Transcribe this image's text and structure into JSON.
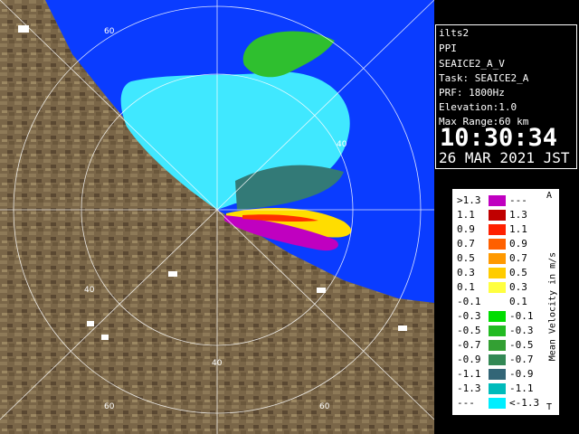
{
  "radar": {
    "site": "ilts2",
    "mode": "PPI",
    "product": "SEAICE2_A_V",
    "task": "Task: SEAICE2_A",
    "prf": "PRF: 1800Hz",
    "elevation": "Elevation:1.0",
    "max_range": "Max Range:60 km",
    "time": "10:30:34",
    "date": "26 MAR 2021 JST"
  },
  "legend": {
    "unit": "Mean Velocity in m/s",
    "corner_top": "A",
    "corner_bottom": "T",
    "rows": [
      {
        "lo": ">1.3",
        "hi": "---",
        "color": "#c000c0"
      },
      {
        "lo": "1.1",
        "hi": "1.3",
        "color": "#c00000"
      },
      {
        "lo": "0.9",
        "hi": "1.1",
        "color": "#ff2000"
      },
      {
        "lo": "0.7",
        "hi": "0.9",
        "color": "#ff6000"
      },
      {
        "lo": "0.5",
        "hi": "0.7",
        "color": "#ff9900"
      },
      {
        "lo": "0.3",
        "hi": "0.5",
        "color": "#ffcc00"
      },
      {
        "lo": "0.1",
        "hi": "0.3",
        "color": "#ffff40"
      },
      {
        "lo": "-0.1",
        "hi": "0.1",
        "color": "#ffffff"
      },
      {
        "lo": "-0.3",
        "hi": "-0.1",
        "color": "#00dd00"
      },
      {
        "lo": "-0.5",
        "hi": "-0.3",
        "color": "#22bb22"
      },
      {
        "lo": "-0.7",
        "hi": "-0.5",
        "color": "#33a033"
      },
      {
        "lo": "-0.9",
        "hi": "-0.7",
        "color": "#338855"
      },
      {
        "lo": "-1.1",
        "hi": "-0.9",
        "color": "#336677"
      },
      {
        "lo": "-1.3",
        "hi": "-1.1",
        "color": "#00bbbb"
      },
      {
        "lo": "---",
        "hi": "<-1.3",
        "color": "#00eeff"
      }
    ]
  },
  "map": {
    "ring_labels": [
      "60",
      "40",
      "40",
      "40",
      "60",
      "60"
    ],
    "colors": {
      "sea": "#0a3cff",
      "land": "#7a6648",
      "range": "#ffffff"
    }
  }
}
